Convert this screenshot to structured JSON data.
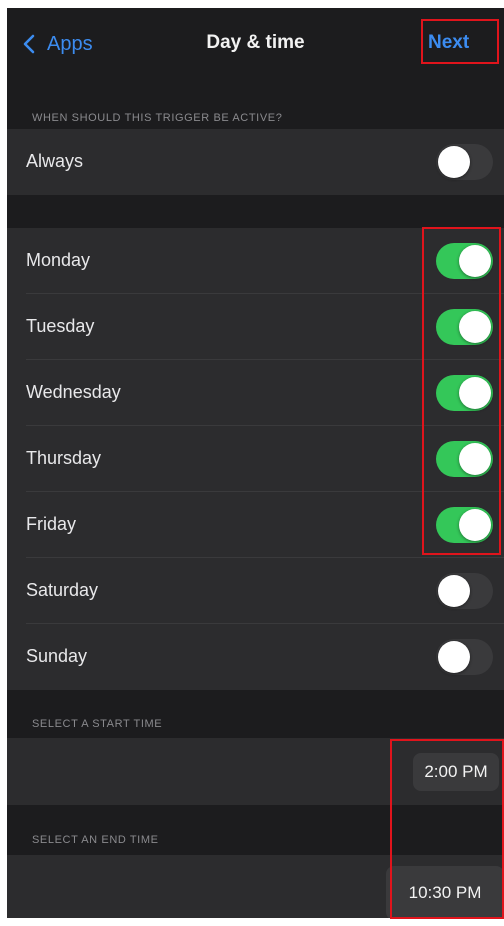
{
  "nav": {
    "back_label": "Apps",
    "title": "Day & time",
    "next_label": "Next"
  },
  "sections": {
    "trigger_header": "WHEN SHOULD THIS TRIGGER BE ACTIVE?",
    "start_header": "SELECT A START TIME",
    "end_header": "SELECT AN END TIME"
  },
  "always": {
    "label": "Always",
    "on": false
  },
  "days": [
    {
      "label": "Monday",
      "on": true
    },
    {
      "label": "Tuesday",
      "on": true
    },
    {
      "label": "Wednesday",
      "on": true
    },
    {
      "label": "Thursday",
      "on": true
    },
    {
      "label": "Friday",
      "on": true
    },
    {
      "label": "Saturday",
      "on": false
    },
    {
      "label": "Sunday",
      "on": false
    }
  ],
  "start_time": "2:00 PM",
  "end_time": "10:30 PM",
  "colors": {
    "accent_blue": "#3c8cf0",
    "toggle_on": "#34c759",
    "highlight": "#e0141c"
  }
}
